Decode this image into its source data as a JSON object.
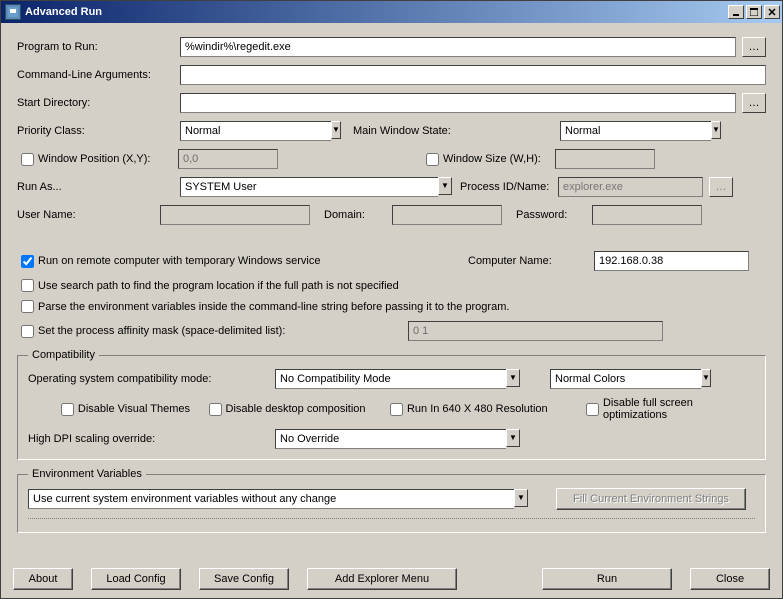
{
  "titlebar": {
    "title": "Advanced Run"
  },
  "labels": {
    "program": "Program to Run:",
    "cmdline": "Command-Line Arguments:",
    "startdir": "Start Directory:",
    "priority": "Priority Class:",
    "mainwin": "Main Window State:",
    "winpos": "Window Position (X,Y):",
    "winsize": "Window Size (W,H):",
    "runas": "Run As...",
    "pidname": "Process ID/Name:",
    "username": "User Name:",
    "domain": "Domain:",
    "password": "Password:",
    "runremote": "Run on remote computer with temporary Windows service",
    "computername": "Computer Name:",
    "usesearchpath": "Use search path to find the program location if the full path is not specified",
    "parseenv": "Parse the environment variables inside the command-line string before passing it to the program.",
    "setaffinity": "Set the process affinity mask (space-delimited list):",
    "compat_legend": "Compatibility",
    "osmode": "Operating system compatibility mode:",
    "disablethemes": "Disable Visual Themes",
    "disablecomp": "Disable desktop composition",
    "run640": "Run In 640 X 480 Resolution",
    "disablefsopt": "Disable full screen optimizations",
    "hidpi": "High DPI scaling override:",
    "env_legend": "Environment Variables",
    "fillenvbtn": "Fill Current Environment Strings"
  },
  "values": {
    "program": "%windir%\\regedit.exe",
    "cmdline": "",
    "startdir": "",
    "priority": "Normal",
    "mainwin": "Normal",
    "winpos": "0,0",
    "winsize": "",
    "runas": "SYSTEM User",
    "pidname_placeholder": "explorer.exe",
    "username": "",
    "domain": "",
    "password": "",
    "computername": "192.168.0.38",
    "affinity": "0 1",
    "compatmode": "No Compatibility Mode",
    "colors": "Normal Colors",
    "hidpi": "No Override",
    "envmode": "Use current system environment variables without any change"
  },
  "buttons": {
    "about": "About",
    "loadconfig": "Load Config",
    "saveconfig": "Save Config",
    "addexplorer": "Add Explorer Menu",
    "run": "Run",
    "close": "Close"
  }
}
